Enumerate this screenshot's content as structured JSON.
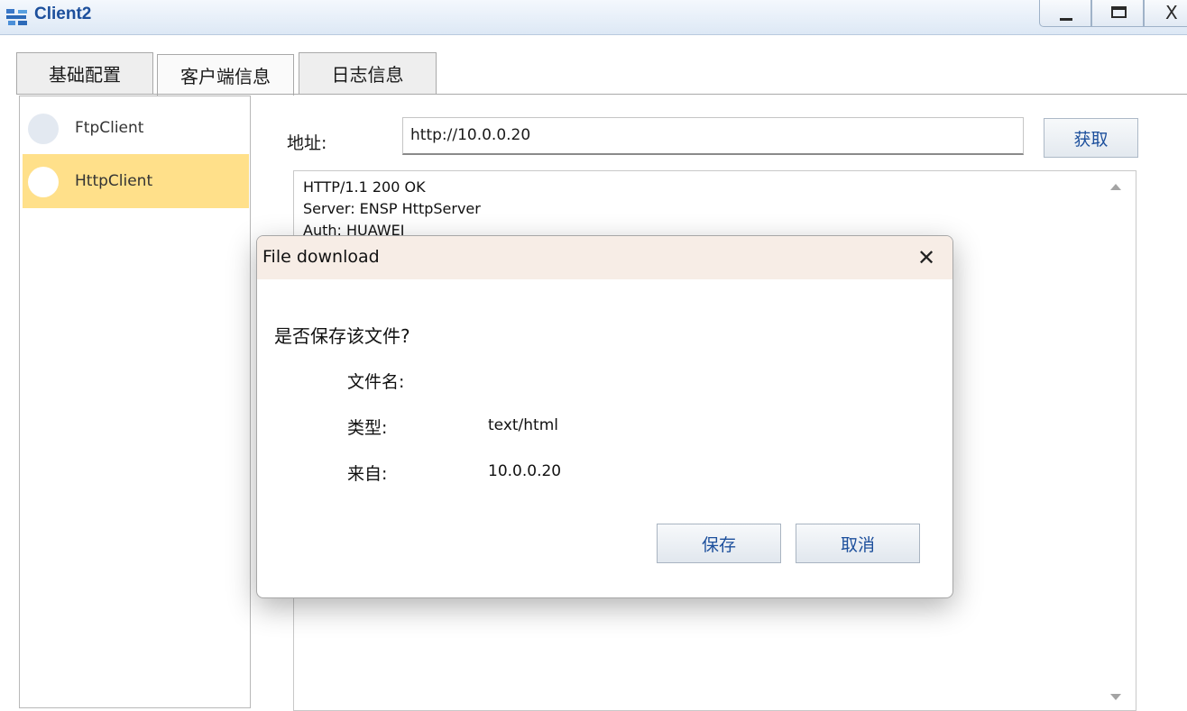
{
  "window": {
    "title": "Client2",
    "minimize_icon": "minimize-icon",
    "maximize_icon": "maximize-icon",
    "close_glyph": "X"
  },
  "tabs": [
    {
      "label": "基础配置"
    },
    {
      "label": "客户端信息",
      "selected": true
    },
    {
      "label": "日志信息"
    }
  ],
  "clients": [
    {
      "label": "FtpClient"
    },
    {
      "label": "HttpClient",
      "selected": true
    }
  ],
  "address": {
    "label": "地址:",
    "value": "http://10.0.0.20",
    "fetch_label": "获取"
  },
  "response_lines": [
    "HTTP/1.1 200 OK",
    "Server: ENSP HttpServer",
    "Auth: HUAWEI"
  ],
  "dialog": {
    "title": "File download",
    "close_glyph": "✕",
    "question": "是否保存该文件?",
    "fields": [
      {
        "label": "文件名:",
        "value": ""
      },
      {
        "label": "类型:",
        "value": "text/html"
      },
      {
        "label": "来自:",
        "value": "10.0.0.20"
      }
    ],
    "save_label": "保存",
    "cancel_label": "取消"
  },
  "colors": {
    "accent_text": "#1c4f9c",
    "selected_item": "#ffe08a",
    "dialog_title_bg": "#f7ede6"
  }
}
